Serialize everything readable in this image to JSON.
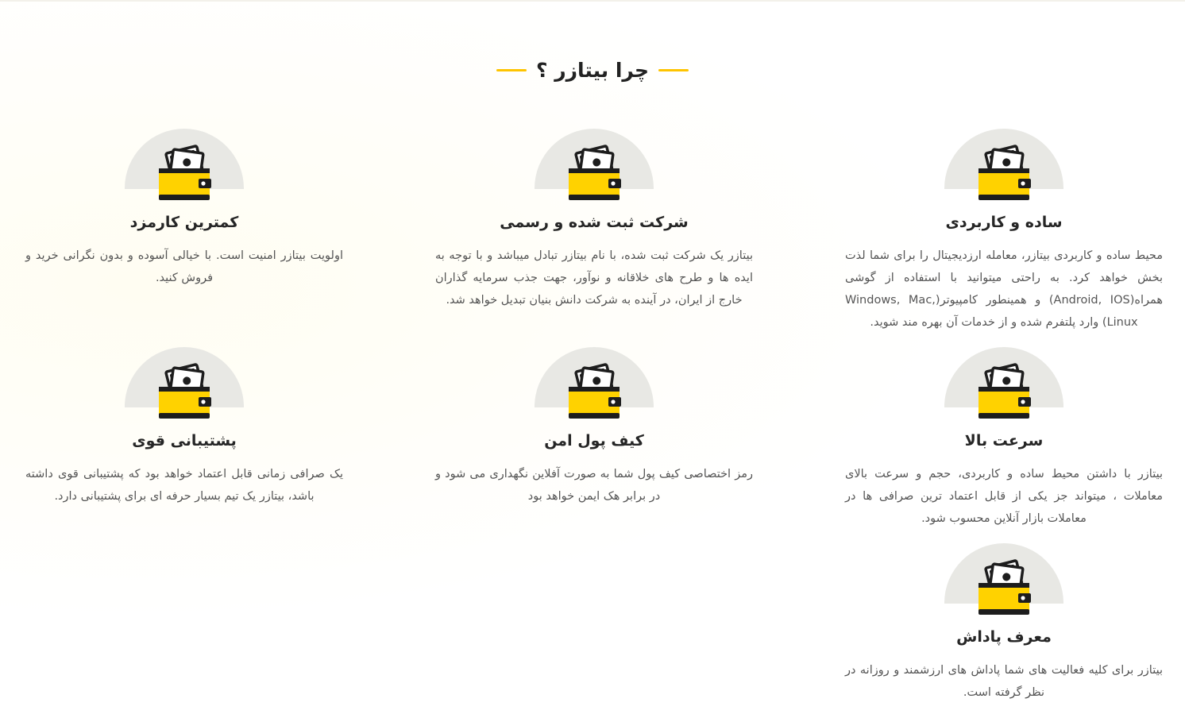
{
  "section": {
    "title": "چرا بیتازر ؟"
  },
  "features": [
    {
      "title": "ساده و کاربردی",
      "description": "محیط ساده و کاربردی بیتازر، معامله ارزدیجیتال را برای شما لذت بخش خواهد کرد. به راحتی میتوانید با استفاده از گوشی همراه(Android, IOS) و همینطور کامپیوتر(Windows, Mac, Linux) وارد پلتفرم شده و از خدمات آن بهره مند شوید.",
      "icon": "wallet-icon"
    },
    {
      "title": "شرکت ثبت شده و رسمی",
      "description": "بیتازر یک شرکت ثبت شده، با نام بیتازر تبادل میباشد و با توجه به ایده ها و طرح های خلاقانه و نوآور، جهت جذب سرمایه گذاران خارج از ایران، در آینده به شرکت دانش بنیان تبدیل خواهد شد.",
      "icon": "wallet-icon"
    },
    {
      "title": "کمترین کارمزد",
      "description": "اولویت بیتازر امنیت است. با خیالی آسوده و بدون نگرانی خرید و فروش کنید.",
      "icon": "wallet-icon"
    },
    {
      "title": "سرعت بالا",
      "description": "بیتازر با داشتن محیط ساده و کاربردی، حجم و سرعت بالای معاملات ، میتواند جز یکی از قابل اعتماد ترین صرافی ها در معاملات بازار آنلاین محسوب شود.",
      "icon": "wallet-icon"
    },
    {
      "title": "کیف پول امن",
      "description": "رمز اختصاصی کیف پول شما به صورت آفلاین نگهداری می شود و در برابر هک ایمن خواهد بود",
      "icon": "wallet-icon"
    },
    {
      "title": "پشتیبانی قوی",
      "description": "یک صرافی زمانی قابل اعتماد خواهد بود که پشتیبانی قوی داشته باشد، بیتازر یک تیم بسیار حرفه ای برای پشتیبانی دارد.",
      "icon": "wallet-icon"
    },
    {
      "title": "معرف پاداش",
      "description": "بیتازر برای کلیه فعالیت های شما پاداش های ارزشمند و روزانه در نظر گرفته است.",
      "icon": "wallet-icon"
    }
  ],
  "colors": {
    "accent": "#fec400",
    "wallet_yellow": "#ffd200",
    "wallet_dark": "#1d1d1d",
    "circle_bg": "#e8e8e4"
  }
}
